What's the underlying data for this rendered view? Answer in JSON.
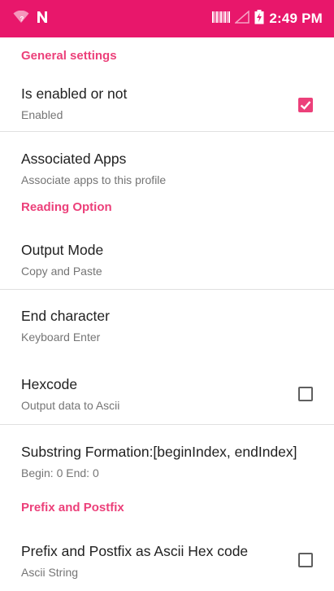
{
  "status_bar": {
    "time": "2:49 PM",
    "icons": [
      "wifi-icon",
      "nfc-n-icon",
      "barcode-icon",
      "signal-icon",
      "battery-charging-icon"
    ],
    "color": "#e8176b"
  },
  "colors": {
    "accent": "#ec407a",
    "title": "#212121",
    "summary": "#757575"
  },
  "sections": {
    "general": "General settings",
    "reading": "Reading Option",
    "prefix": "Prefix and Postfix"
  },
  "items": {
    "enabled": {
      "title": "Is enabled or not",
      "summary": "Enabled",
      "checked": true
    },
    "apps": {
      "title": "Associated Apps",
      "summary": "Associate apps to this profile"
    },
    "output": {
      "title": "Output Mode",
      "summary": "Copy and Paste"
    },
    "endchar": {
      "title": "End character",
      "summary": "Keyboard Enter"
    },
    "hexcode": {
      "title": "Hexcode",
      "summary": "Output data to Ascii",
      "checked": false
    },
    "substring": {
      "title": "Substring Formation:[beginIndex, endIndex]",
      "summary": "Begin: 0 End: 0"
    },
    "prefixhex": {
      "title": "Prefix and Postfix as Ascii Hex code",
      "summary": "Ascii String",
      "checked": false
    }
  }
}
